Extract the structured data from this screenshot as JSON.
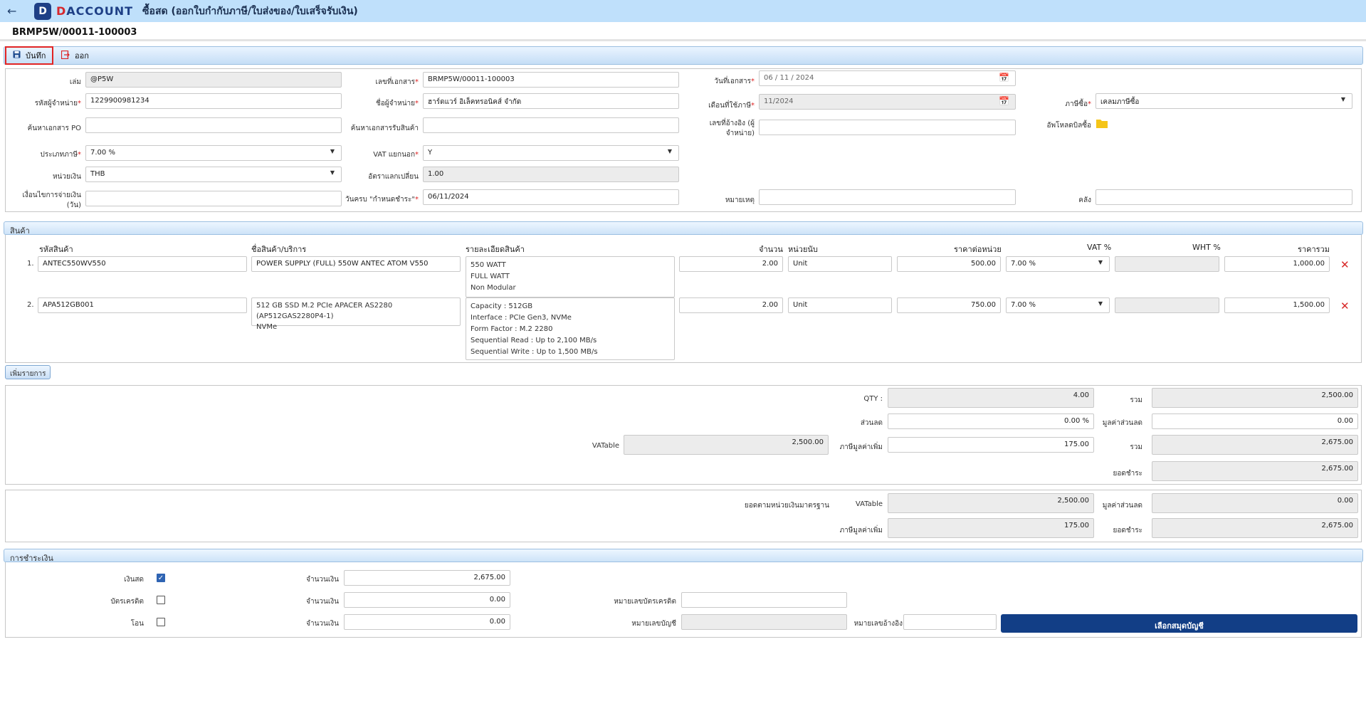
{
  "app": {
    "back_icon": "back-arrow-icon",
    "logo_badge": "D",
    "logo_text_d": "D",
    "logo_text_rest": "ACCOUNT",
    "title": "ซื้อสด (ออกใบกำกับภาษี/ใบส่งของ/ใบเสร็จรับเงิน)"
  },
  "document_number": "BRMP5W/00011-100003",
  "toolbar": {
    "save_label": "บันทึก",
    "exit_label": "ออก"
  },
  "header": {
    "book_label": "เล่ม",
    "book_value": "@P5W",
    "doc_no_label": "เลขที่เอกสาร",
    "doc_no_value": "BRMP5W/00011-100003",
    "doc_date_label": "วันที่เอกสาร",
    "doc_date_value": "06 / 11 / 2024",
    "vendor_code_label": "รหัสผู้จำหน่าย",
    "vendor_code_value": "1229900981234",
    "vendor_name_label": "ชื่อผู้จำหน่าย",
    "vendor_name_value": "ฮาร์ดแวร์ อิเล็คทรอนิคส์ จำกัด",
    "tax_month_label": "เดือนที่ใช้ภาษี",
    "tax_month_value": "11/2024",
    "purchase_tax_label": "ภาษีซื้อ",
    "purchase_tax_value": "เคลมภาษีซื้อ",
    "po_search_label": "ค้นหาเอกสาร PO",
    "po_search_value": "",
    "receipt_search_label": "ค้นหาเอกสารรับสินค้า",
    "receipt_search_value": "",
    "ref_no_label_line1": "เลขที่อ้างอิง (ผู้",
    "ref_no_label_line2": "จำหน่าย)",
    "ref_no_value": "",
    "upload_label": "อัพโหลดบิลซื้อ",
    "vat_type_label": "ประเภทภาษี",
    "vat_type_value": "7.00 %",
    "vat_separate_label": "VAT แยกนอก",
    "vat_separate_value": "Y",
    "currency_label": "หน่วยเงิน",
    "currency_value": "THB",
    "rate_label": "อัตราแลกเปลี่ยน",
    "rate_value": "1.00",
    "credit_label_line1": "เงื่อนไขการจ่ายเงิน",
    "credit_label_line2": "(วัน)",
    "credit_value": "",
    "due_label": "วันครบ \"กำหนดชำระ\"",
    "due_value": "06/11/2024",
    "note_label": "หมายเหตุ",
    "note_value": "",
    "warehouse_label": "คลัง",
    "warehouse_value": ""
  },
  "items_section": {
    "title": "สินค้า",
    "columns": [
      "รหัสสินค้า",
      "ชื่อสินค้า/บริการ",
      "รายละเอียดสินค้า",
      "จำนวน",
      "หน่วยนับ",
      "ราคาต่อหน่วย",
      "VAT %",
      "WHT %",
      "ราคารวม"
    ],
    "rows": [
      {
        "no": "1.",
        "code": "ANTEC550WV550",
        "name_line1": "POWER SUPPLY (FULL) 550W ANTEC ATOM V550",
        "name_line2": "",
        "detail": [
          "550 WATT",
          "FULL WATT",
          "Non Modular"
        ],
        "qty": "2.00",
        "unit": "Unit",
        "price": "500.00",
        "vat": "7.00 %",
        "wht": "",
        "total": "1,000.00"
      },
      {
        "no": "2.",
        "code": "APA512GB001",
        "name_line1": "512 GB SSD M.2 PCIe APACER AS2280 (AP512GAS2280P4-1)",
        "name_line2": "NVMe",
        "detail": [
          "Capacity : 512GB",
          "Interface : PCIe Gen3, NVMe",
          "Form Factor : M.2 2280",
          "Sequential Read : Up to 2,100 MB/s",
          "Sequential Write : Up to 1,500 MB/s"
        ],
        "qty": "2.00",
        "unit": "Unit",
        "price": "750.00",
        "vat": "7.00 %",
        "wht": "",
        "total": "1,500.00"
      }
    ],
    "add_label": "เพิ่มรายการ"
  },
  "summary": {
    "qty_label": "QTY :",
    "qty_value": "4.00",
    "sum_label": "รวม",
    "sum_value": "2,500.00",
    "discount_label": "ส่วนลด",
    "discount_value": "0.00 %",
    "discount_amount_label": "มูลค่าส่วนลด",
    "discount_amount_value": "0.00",
    "vatable_label": "VATable",
    "vatable_value": "2,500.00",
    "vat_label": "ภาษีมูลค่าเพิ่ม",
    "vat_value": "175.00",
    "total_label": "รวม",
    "total_value": "2,675.00",
    "pay_label": "ยอดชำระ",
    "pay_value": "2,675.00"
  },
  "base_summary": {
    "title": "ยอดตามหน่วยเงินมาตรฐาน",
    "vatable_label": "VATable",
    "vatable_value": "2,500.00",
    "discount_label": "มูลค่าส่วนลด",
    "discount_value": "0.00",
    "vat_label": "ภาษีมูลค่าเพิ่ม",
    "vat_value": "175.00",
    "pay_label": "ยอดชำระ",
    "pay_value": "2,675.00"
  },
  "payment": {
    "title": "การชำระเงิน",
    "cash_label": "เงินสด",
    "cash_checked": true,
    "cash_amount_label": "จำนวนเงิน",
    "cash_amount": "2,675.00",
    "card_label": "บัตรเครดิต",
    "card_checked": false,
    "card_amount_label": "จำนวนเงิน",
    "card_amount": "0.00",
    "card_no_label": "หมายเลขบัตรเครดิต",
    "card_no_value": "",
    "transfer_label": "โอน",
    "transfer_checked": false,
    "transfer_amount_label": "จำนวนเงิน",
    "transfer_amount": "0.00",
    "account_no_label": "หมายเลขบัญชี",
    "account_no_value": "",
    "ref_label": "หมายเลขอ้างอิง",
    "ref_value": "",
    "choose_account_label": "เลือกสมุดบัญชี"
  }
}
